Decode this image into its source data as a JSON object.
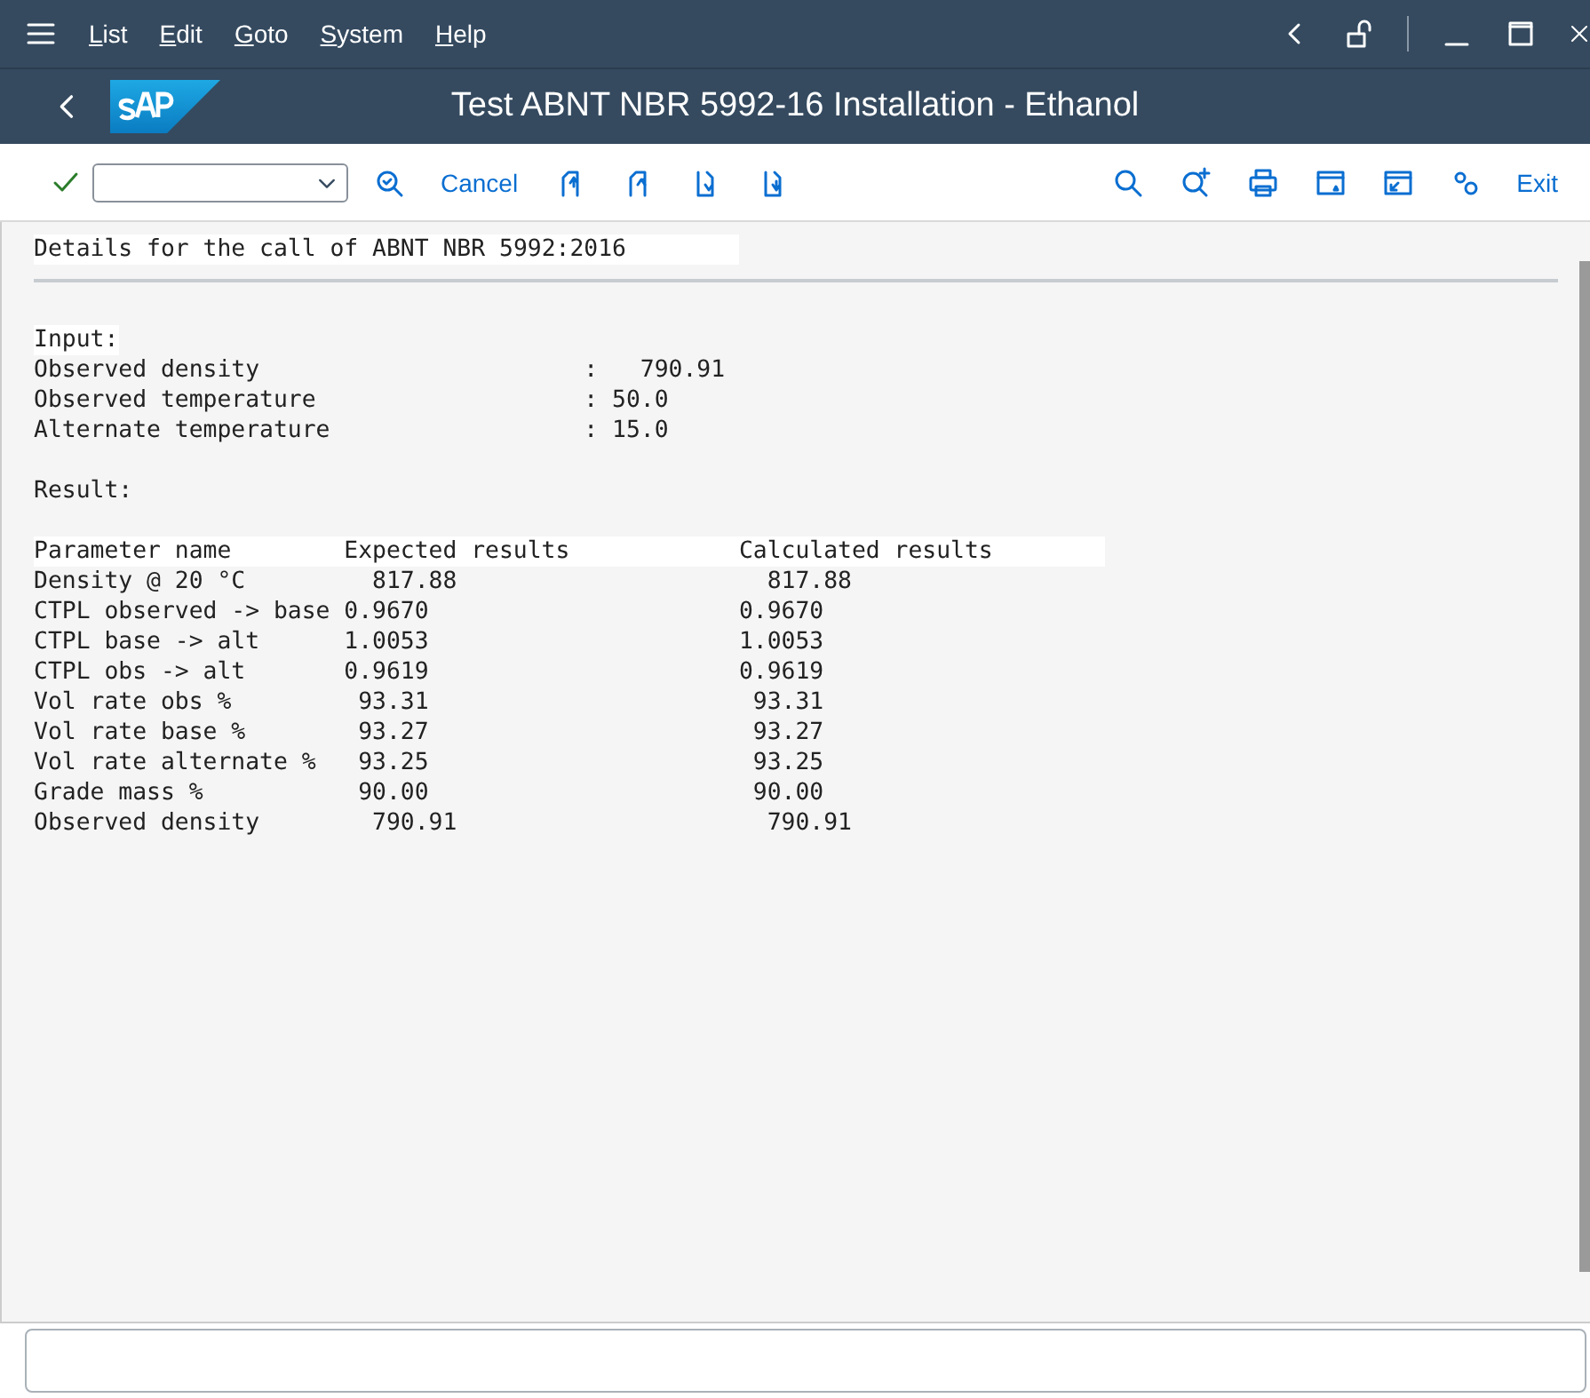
{
  "menu": [
    {
      "label": "List"
    },
    {
      "label": "Edit"
    },
    {
      "label": "Goto"
    },
    {
      "label": "System"
    },
    {
      "label": "Help"
    }
  ],
  "title": "Test ABNT NBR 5992-16 Installation - Ethanol",
  "toolbar": {
    "cancel": "Cancel",
    "exit": "Exit"
  },
  "report": {
    "heading": "Details for the call of ABNT NBR 5992:2016",
    "input_heading": "Input:",
    "inputs": [
      {
        "label": "Observed density",
        "value": ":   790.91"
      },
      {
        "label": "Observed temperature",
        "value": ": 50.0"
      },
      {
        "label": "Alternate temperature",
        "value": ": 15.0"
      }
    ],
    "result_heading": "Result:",
    "columns": [
      "Parameter name",
      "Expected results",
      "Calculated results"
    ],
    "rows": [
      {
        "parameter": "Density @ 20 °C",
        "expected": "  817.88",
        "calculated": "  817.88"
      },
      {
        "parameter": "CTPL observed -> base",
        "expected": "0.9670",
        "calculated": "0.9670"
      },
      {
        "parameter": "CTPL base -> alt",
        "expected": "1.0053",
        "calculated": "1.0053"
      },
      {
        "parameter": "CTPL obs -> alt",
        "expected": "0.9619",
        "calculated": "0.9619"
      },
      {
        "parameter": "Vol rate obs %",
        "expected": " 93.31",
        "calculated": " 93.31"
      },
      {
        "parameter": "Vol rate base %",
        "expected": " 93.27",
        "calculated": " 93.27"
      },
      {
        "parameter": "Vol rate alternate %",
        "expected": " 93.25",
        "calculated": " 93.25"
      },
      {
        "parameter": "Grade mass %",
        "expected": " 90.00",
        "calculated": " 90.00"
      },
      {
        "parameter": "Observed density",
        "expected": "  790.91",
        "calculated": "  790.91"
      }
    ]
  }
}
